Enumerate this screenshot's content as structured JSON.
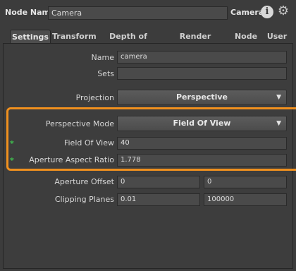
{
  "header": {
    "node_name_label": "Node Name",
    "node_name_value": "Camera",
    "node_type": "Camera",
    "info_icon": "info-icon",
    "settings_icon": "gear-icon"
  },
  "tabs": [
    {
      "label": "Settings",
      "active": true
    },
    {
      "label": "Transform"
    },
    {
      "label": "Depth of Field"
    },
    {
      "label": "Render Overrides"
    },
    {
      "label": "Node"
    },
    {
      "label": "User"
    }
  ],
  "fields": {
    "name": {
      "label": "Name",
      "value": "camera"
    },
    "sets": {
      "label": "Sets",
      "value": ""
    },
    "projection": {
      "label": "Projection",
      "value": "Perspective"
    },
    "perspective_mode": {
      "label": "Perspective Mode",
      "value": "Field Of View"
    },
    "field_of_view": {
      "label": "Field Of View",
      "value": "40",
      "marker": "*"
    },
    "aperture_aspect_ratio": {
      "label": "Aperture Aspect Ratio",
      "value": "1.778",
      "marker": "*"
    },
    "aperture_offset": {
      "label": "Aperture Offset",
      "x": "0",
      "y": "0"
    },
    "clipping_planes": {
      "label": "Clipping Planes",
      "near": "0.01",
      "far": "100000"
    }
  },
  "colors": {
    "highlight_border": "#f0901e",
    "modified_marker": "#3fbf4f",
    "background": "#3c3c3c"
  }
}
